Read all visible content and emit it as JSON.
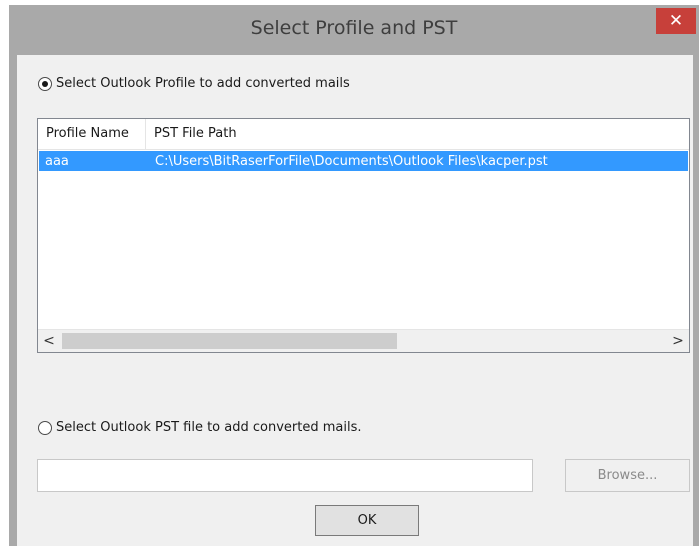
{
  "window": {
    "title": "Select Profile and PST",
    "close_glyph": "✕",
    "colors": {
      "frame": "#a9a9a9",
      "close": "#c7403a",
      "selection": "#3399ff"
    }
  },
  "option_profile": {
    "label": "Select Outlook Profile to add converted mails",
    "checked": true
  },
  "table": {
    "columns": [
      "Profile Name",
      "PST File Path"
    ],
    "rows": [
      {
        "profile": "aaa",
        "path": "C:\\Users\\BitRaserForFile\\Documents\\Outlook Files\\kacper.pst",
        "selected": true
      }
    ]
  },
  "scrollbar": {
    "left_glyph": "<",
    "right_glyph": ">"
  },
  "option_pst": {
    "label": "Select Outlook PST file to add converted mails.",
    "checked": false
  },
  "pst_path": {
    "value": ""
  },
  "buttons": {
    "browse": "Browse...",
    "ok": "OK"
  }
}
